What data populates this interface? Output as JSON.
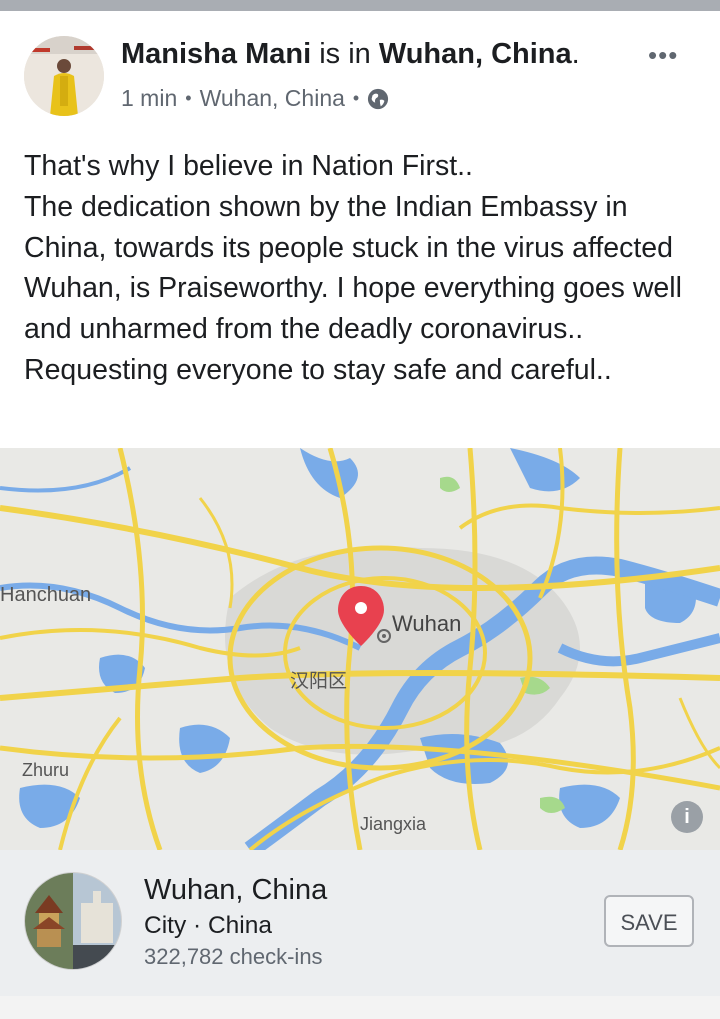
{
  "post": {
    "author": "Manisha Mani",
    "is_in": "is in",
    "location": "Wuhan, China",
    "period": ".",
    "time": "1 min",
    "place": "Wuhan, China",
    "privacy_icon": "globe-icon",
    "more_icon": "•••",
    "text": "That's why I believe in Nation First..\nThe dedication shown by the Indian Embassy in China, towards its people stuck in the virus affected Wuhan, is Praiseworthy. I hope everything goes well and unharmed from the deadly coronavirus..\nRequesting everyone to stay safe and careful.."
  },
  "map": {
    "labels": {
      "hanchuan": "Hanchuan",
      "wuhan": "Wuhan",
      "hanyang": "汉阳区",
      "zhuru": "Zhuru",
      "jiangxia": "Jiangxia"
    },
    "info_label": "i",
    "colors": {
      "water": "#79abe8",
      "road": "#f1d34a",
      "urban": "#d9d9d6",
      "pin": "#e8414f"
    }
  },
  "place_card": {
    "name": "Wuhan, China",
    "type": "City · China",
    "checkins": "322,782 check-ins",
    "save_label": "SAVE"
  }
}
